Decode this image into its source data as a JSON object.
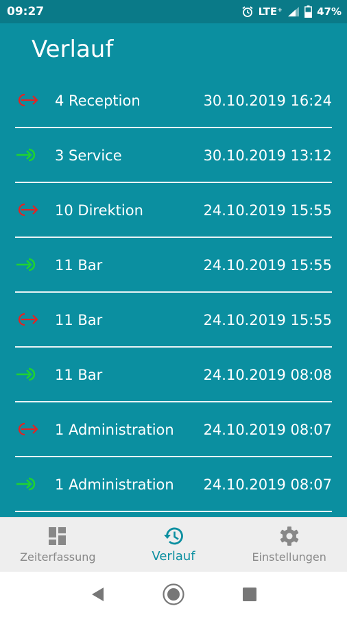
{
  "status_bar": {
    "time": "09:27",
    "network": "LTE⁺",
    "battery": "47%"
  },
  "page": {
    "title": "Verlauf"
  },
  "colors": {
    "header": "#0a7a88",
    "background": "#0b8fa0",
    "check_in": "#1ed232",
    "check_out": "#e52222",
    "nav_active": "#0b8fa0"
  },
  "history": [
    {
      "type": "check-out",
      "icon": "check-out-icon",
      "label": "4 Reception",
      "time": "30.10.2019 16:24"
    },
    {
      "type": "check-in",
      "icon": "check-in-icon",
      "label": "3 Service",
      "time": "30.10.2019 13:12"
    },
    {
      "type": "check-out",
      "icon": "check-out-icon",
      "label": "10 Direktion",
      "time": "24.10.2019 15:55"
    },
    {
      "type": "check-in",
      "icon": "check-in-icon",
      "label": "11 Bar",
      "time": "24.10.2019 15:55"
    },
    {
      "type": "check-out",
      "icon": "check-out-icon",
      "label": "11 Bar",
      "time": "24.10.2019 15:55"
    },
    {
      "type": "check-in",
      "icon": "check-in-icon",
      "label": "11 Bar",
      "time": "24.10.2019 08:08"
    },
    {
      "type": "check-out",
      "icon": "check-out-icon",
      "label": "1 Administration",
      "time": "24.10.2019 08:07"
    },
    {
      "type": "check-in",
      "icon": "check-in-icon",
      "label": "1 Administration",
      "time": "24.10.2019 08:07"
    }
  ],
  "bottom_nav": [
    {
      "label": "Zeiterfassung",
      "icon": "dashboard-icon",
      "active": false
    },
    {
      "label": "Verlauf",
      "icon": "history-icon",
      "active": true
    },
    {
      "label": "Einstellungen",
      "icon": "gear-icon",
      "active": false
    }
  ],
  "system_nav": {
    "back": "back-icon",
    "home": "home-icon",
    "recents": "recents-icon"
  }
}
